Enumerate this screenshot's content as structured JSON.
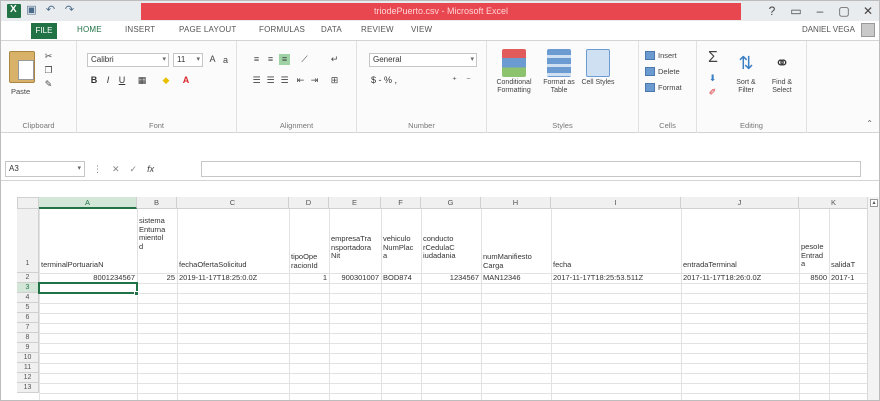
{
  "window": {
    "title": "triodePuerto.csv - Microsoft Excel",
    "controls": [
      "?",
      "▭",
      "–",
      "▢",
      "✕"
    ]
  },
  "ribbon_tabs": {
    "file": "FILE",
    "items": [
      "HOME",
      "INSERT",
      "PAGE LAYOUT",
      "FORMULAS",
      "DATA",
      "REVIEW",
      "VIEW"
    ],
    "user": "DANIEL VEGA"
  },
  "clipboard": {
    "paste": "Paste",
    "label": "Clipboard"
  },
  "font": {
    "name": "Calibri",
    "size": "11",
    "label": "Font"
  },
  "alignment": {
    "label": "Alignment"
  },
  "number": {
    "format": "General",
    "symbols": "$ - % ,",
    "label": "Number"
  },
  "styles": {
    "conditional": "Conditional Formatting",
    "format_table": "Format as Table",
    "cell_styles": "Cell Styles",
    "label": "Styles"
  },
  "cells": {
    "insert": "Insert",
    "delete": "Delete",
    "format": "Format",
    "label": "Cells"
  },
  "editing": {
    "sum": "Σ",
    "sort": "Sort & Filter",
    "find": "Find & Select",
    "label": "Editing"
  },
  "formula_bar": {
    "name_box": "A3",
    "fx": "fx",
    "value": ""
  },
  "sheet": {
    "columns": [
      "A",
      "B",
      "C",
      "D",
      "E",
      "F",
      "G",
      "H",
      "I",
      "J",
      "K"
    ],
    "rows": [
      "1",
      "2",
      "3",
      "4",
      "5",
      "6",
      "7",
      "8",
      "9",
      "10",
      "11",
      "12",
      "13"
    ],
    "headers": [
      "terminalPortuariaN",
      "sistema\nEnturna\nmientol\nd",
      "fechaOfertaSolicitud",
      "tipoOpe\nracionId",
      "empresaTra\nnsportadora\nNit",
      "vehiculo\nNumPlac\na",
      "conducto\nrCedulaC\niudadania",
      "numManifiesto\nCarga",
      "fecha",
      "entradaTerminal",
      "pesoIe\nEntrad\na"
    ],
    "row2": [
      "8001234567",
      "25",
      "2019-11-17T18:25:0.0Z",
      "1",
      "900301007",
      "BOD874",
      "1234567",
      "MAN12346",
      "2017-11-17T18:25:53.511Z",
      "2017-11-17T18:26:0.0Z",
      "8500"
    ],
    "extra_header": "salidaT",
    "extra_value": "2017-1"
  }
}
